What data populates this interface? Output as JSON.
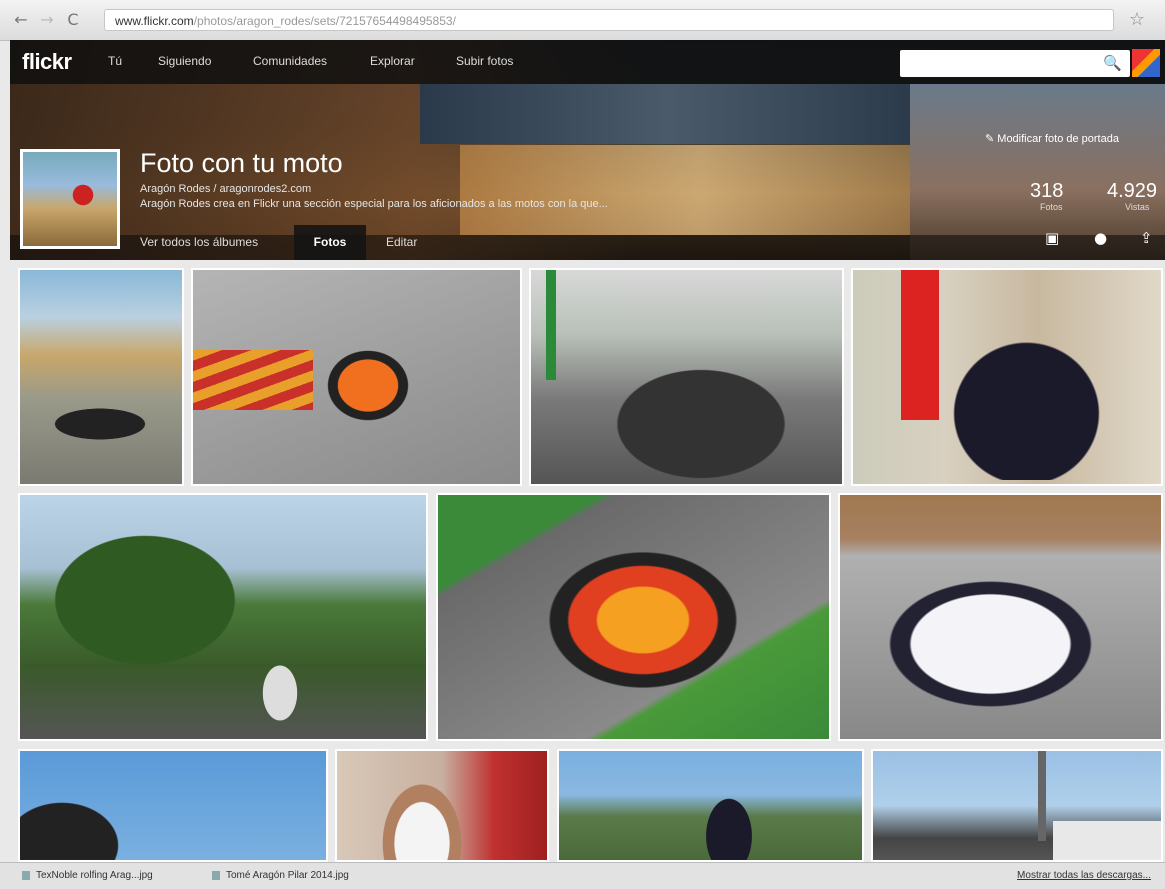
{
  "browser": {
    "back_icon": "←",
    "forward_icon": "→",
    "reload_icon": "C",
    "url_host": "www.flickr.com",
    "url_path": "/photos/aragon_rodes/sets/72157654498495853/",
    "star_icon": "☆"
  },
  "topnav": {
    "logo": "flickr",
    "items": [
      "Tú",
      "Siguiendo",
      "Comunidades",
      "Explorar",
      "Subir fotos"
    ],
    "search_placeholder": "",
    "search_icon": "🔍"
  },
  "album": {
    "title": "Foto con tu moto",
    "owner": "Aragón Rodes / aragonrodes2.com",
    "description": "Aragón Rodes crea en Flickr una sección especial para los aficionados a las motos con la que...",
    "tabs": [
      "Ver todos los álbumes",
      "Fotos",
      "Editar"
    ],
    "active_tab": "Fotos",
    "edit_cover": "Modificar foto de portada",
    "stats": [
      {
        "value": "318",
        "label": "Fotos"
      },
      {
        "value": "4.929",
        "label": "Vistas"
      }
    ],
    "actions": [
      "slideshow-icon",
      "comment-icon",
      "share-icon"
    ]
  },
  "downloads": {
    "items": [
      "TexNoble rolfing Arag...jpg",
      "Tomé Aragón Pilar 2014.jpg"
    ],
    "show_all": "Mostrar todas las descargas..."
  }
}
